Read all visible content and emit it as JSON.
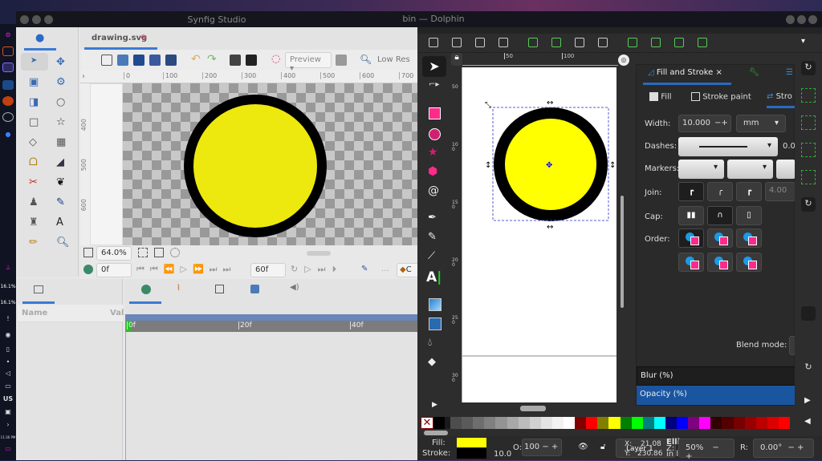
{
  "synfig": {
    "title": "Synfig Studio",
    "doc_tab": "drawing.svg",
    "preview": "Preview",
    "low_res": "Low Res",
    "ruler_top": [
      "0",
      "100",
      "200",
      "300",
      "400",
      "500",
      "600",
      "700"
    ],
    "ruler_left": [
      "400",
      "500",
      "600"
    ],
    "zoom": "64.0%",
    "current_frame": "0f",
    "end_frame": "60f",
    "ellipsis": "...",
    "keyframe_lock": "C",
    "params": {
      "name_col": "Name",
      "value_col": "Val"
    },
    "timeline_ticks": [
      "0f",
      "20f",
      "40f"
    ]
  },
  "dock": {
    "battery1": "16.1%",
    "battery2": "16.1%",
    "keyboard": "US",
    "clock": "11:36 PM"
  },
  "inkscape": {
    "title": "bin — Dolphin",
    "ruler_top": [
      "50",
      "100"
    ],
    "ruler_left": [
      "50",
      "100",
      "150",
      "200",
      "250",
      "300"
    ],
    "panel": {
      "tab": "Fill and Stroke",
      "fill": "Fill",
      "stroke_paint": "Stroke paint",
      "stroke_style": "Stro",
      "width_label": "Width:",
      "width_value": "10.000",
      "unit": "mm",
      "dashes_label": "Dashes:",
      "dash_offset": "0.0",
      "markers_label": "Markers:",
      "join_label": "Join:",
      "miter": "4.00",
      "cap_label": "Cap:",
      "order_label": "Order:",
      "blend_label": "Blend mode:",
      "blur": "Blur (%)",
      "opacity": "Opacity (%)"
    },
    "status": {
      "fill_label": "Fill:",
      "stroke_label": "Stroke:",
      "stroke_width": "10.0",
      "opacity_label": "O:",
      "opacity": "100",
      "layer": "Layer 1",
      "x_label": "X:",
      "x": "21.08",
      "y_label": "Y:",
      "y": "230.86",
      "obj": "Elli",
      "obj2": "in l",
      "z_label": "Z:",
      "zoom": "50%",
      "rot_label": "R:",
      "rotation": "0.00°"
    },
    "fill_color": "#ffff00",
    "stroke_color": "#000000",
    "palette": [
      "#000000",
      "#1a1a1a",
      "#333333",
      "#4d4d4d",
      "#5a5a5a",
      "#6e6e6e",
      "#808080",
      "#949494",
      "#a8a8a8",
      "#bcbcbc",
      "#d0d0d0",
      "#e4e4e4",
      "#f2f2f2",
      "#ffffff",
      "#800000",
      "#ff0000",
      "#808000",
      "#ffff00",
      "#008000",
      "#00ff00",
      "#008080",
      "#00ffff",
      "#000080",
      "#0000ff",
      "#800080",
      "#ff00ff",
      "#330000",
      "#550000",
      "#770000",
      "#990000",
      "#bb0000",
      "#dd0000",
      "#ff0000"
    ]
  }
}
